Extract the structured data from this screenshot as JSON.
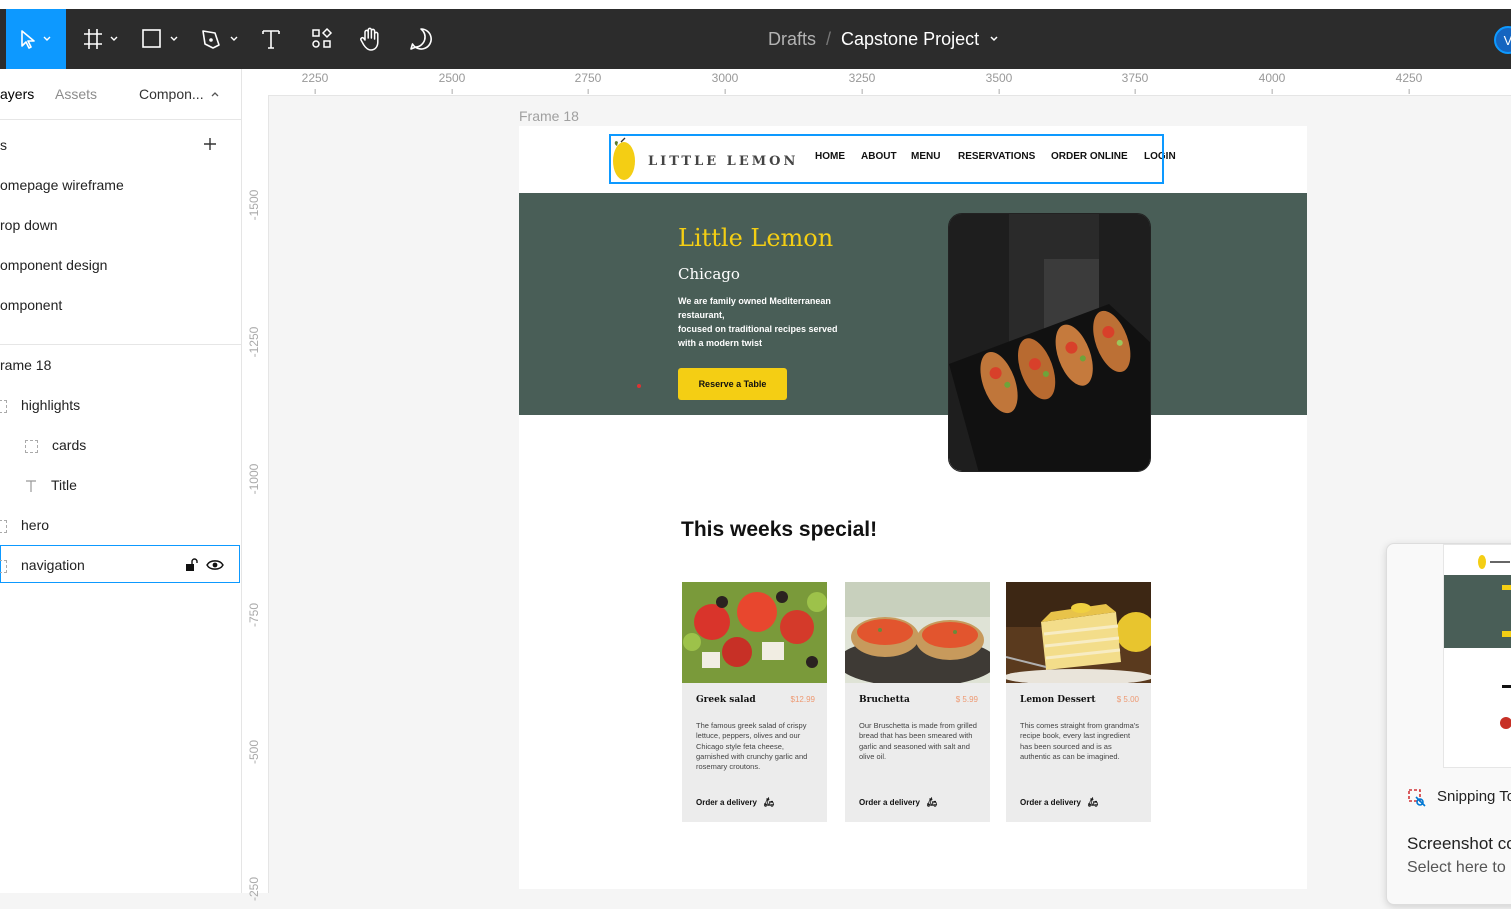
{
  "toolbar": {
    "breadcrumb_parent": "Drafts",
    "breadcrumb_sep": "/",
    "project_name": "Capstone Project",
    "avatar_initial": "V"
  },
  "left_panel": {
    "tabs": [
      "ayers",
      "Assets",
      "Compon..."
    ],
    "pages_header": "s",
    "pages": [
      "omepage wireframe",
      "rop down",
      "omponent design",
      "omponent"
    ],
    "layers_root": "rame 18",
    "layers": [
      {
        "label": "highlights",
        "depth": 1
      },
      {
        "label": "cards",
        "depth": 2
      },
      {
        "label": "Title",
        "depth": 2
      },
      {
        "label": "hero",
        "depth": 1
      },
      {
        "label": "navigation",
        "depth": 1
      }
    ]
  },
  "rulers": {
    "h_ticks": [
      "2250",
      "2500",
      "2750",
      "3000",
      "3250",
      "3500",
      "3750",
      "4000",
      "4250"
    ],
    "v_ticks": [
      "-1500",
      "-1250",
      "-1000",
      "-750",
      "-500",
      "-250"
    ]
  },
  "canvas": {
    "frame_label": "Frame 18",
    "nav": {
      "logo": "LITTLE LEMON",
      "links": [
        "HOME",
        "ABOUT",
        "MENU",
        "RESERVATIONS",
        "ORDER ONLINE",
        "LOGIN"
      ]
    },
    "hero": {
      "title": "Little Lemon",
      "subtitle": "Chicago",
      "desc1": "We are family owned Mediterranean restaurant,",
      "desc2": "focused on traditional recipes served with a modern twist",
      "button": "Reserve a Table"
    },
    "specials_title": "This weeks special!",
    "cards": [
      {
        "name": "Greek salad",
        "price": "$12.99",
        "desc": "The famous greek salad of crispy lettuce, peppers, olives and our Chicago style feta cheese, garnished with crunchy garlic and rosemary croutons.",
        "order": "Order a delivery"
      },
      {
        "name": "Bruchetta",
        "price": "$ 5.99",
        "desc": "Our Bruschetta is made from grilled bread that has been smeared with garlic and seasoned with salt and olive oil.",
        "order": "Order a delivery"
      },
      {
        "name": "Lemon Dessert",
        "price": "$ 5.00",
        "desc": "This comes straight from grandma's recipe book, every last ingredient has been sourced and is as authentic as can be imagined.",
        "order": "Order a delivery"
      }
    ]
  },
  "snip": {
    "app": "Snipping To",
    "title": "Screenshot co",
    "subtitle": "Select here to"
  },
  "colors": {
    "accent": "#0d99ff",
    "hero_bg": "#495e57",
    "lemon_yellow": "#f4ce14",
    "price": "#ee9972"
  }
}
